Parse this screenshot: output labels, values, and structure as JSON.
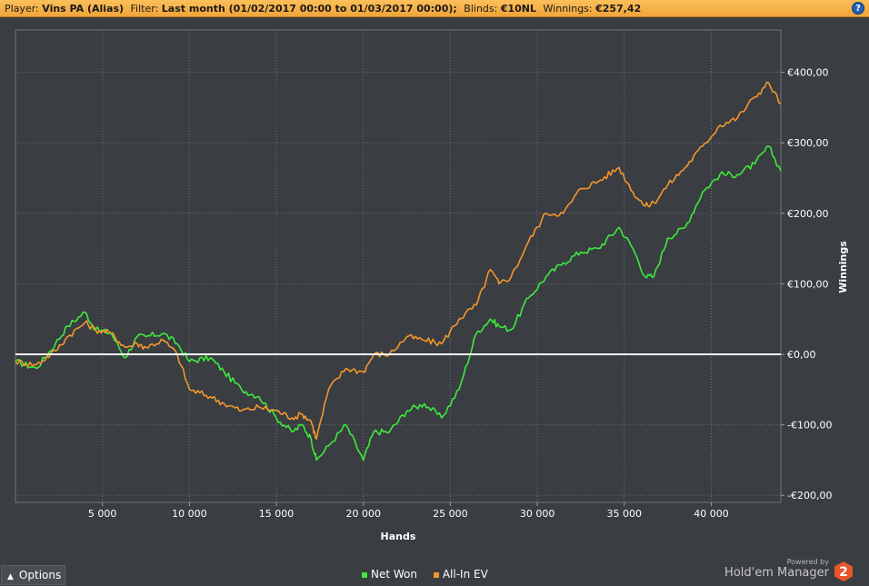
{
  "header": {
    "player_label": "Player:",
    "player_value": "Vins PA (Alias)",
    "filter_label": "Filter:",
    "filter_value": "Last month (01/02/2017 00:00 to 01/03/2017 00:00);",
    "blinds_label": "Blinds:",
    "blinds_value": "€10NL",
    "winnings_label": "Winnings:",
    "winnings_value": "€257,42",
    "help_label": "?"
  },
  "colors": {
    "background": "#3a3d41",
    "header": "#f5ad45",
    "net_won": "#3ee93e",
    "all_in_ev": "#f2962e",
    "zero_line": "#ffffff",
    "grid": "#6b6e73"
  },
  "chart_data": {
    "type": "line",
    "xlabel": "Hands",
    "ylabel": "Winnings",
    "xlim": [
      0,
      44000
    ],
    "ylim": [
      -210,
      460
    ],
    "x_ticks": [
      5000,
      10000,
      15000,
      20000,
      25000,
      30000,
      35000,
      40000
    ],
    "x_tick_labels": [
      "5 000",
      "10 000",
      "15 000",
      "20 000",
      "25 000",
      "30 000",
      "35 000",
      "40 000"
    ],
    "y_ticks": [
      -200,
      -100,
      0,
      100,
      200,
      300,
      400
    ],
    "y_tick_labels": [
      "-€200,00",
      "-€100,00",
      "€0,00",
      "€100,00",
      "€200,00",
      "€300,00",
      "€400,00"
    ],
    "grid": true,
    "legend_position": "bottom-center",
    "series": [
      {
        "name": "Net Won",
        "color": "#3ee93e",
        "x": [
          0,
          1200,
          2300,
          3000,
          4000,
          4600,
          5500,
          6300,
          7000,
          7500,
          8500,
          9300,
          10000,
          11200,
          12000,
          13000,
          14000,
          15000,
          15900,
          16500,
          17000,
          17300,
          18000,
          19000,
          20000,
          20600,
          21500,
          22500,
          23500,
          24500,
          25500,
          26500,
          27300,
          27800,
          28500,
          29500,
          30500,
          31500,
          32500,
          33500,
          34700,
          35500,
          36200,
          36700,
          37500,
          38500,
          39500,
          40500,
          41500,
          42500,
          43300,
          44000
        ],
        "y": [
          -10,
          -20,
          15,
          40,
          60,
          35,
          30,
          -5,
          25,
          25,
          30,
          15,
          -10,
          -5,
          -25,
          -50,
          -60,
          -90,
          -110,
          -100,
          -120,
          -150,
          -130,
          -100,
          -150,
          -110,
          -110,
          -80,
          -70,
          -90,
          -50,
          30,
          50,
          40,
          35,
          80,
          110,
          130,
          145,
          150,
          180,
          150,
          110,
          110,
          165,
          180,
          230,
          255,
          255,
          270,
          295,
          260
        ]
      },
      {
        "name": "All-In EV",
        "color": "#f2962e",
        "x": [
          0,
          1200,
          2300,
          3000,
          4000,
          4600,
          5500,
          6300,
          7000,
          7500,
          8500,
          9300,
          10000,
          11200,
          12000,
          13000,
          14000,
          15000,
          15900,
          16500,
          17000,
          17300,
          18000,
          19000,
          20000,
          20600,
          21500,
          22500,
          23500,
          24500,
          25500,
          26500,
          27300,
          27800,
          28500,
          29500,
          30500,
          31500,
          32500,
          33500,
          34700,
          35500,
          36200,
          36700,
          37500,
          38500,
          39500,
          40500,
          41500,
          42500,
          43300,
          44000
        ],
        "y": [
          -10,
          -15,
          5,
          25,
          45,
          35,
          30,
          10,
          15,
          10,
          20,
          0,
          -50,
          -60,
          -70,
          -80,
          -75,
          -80,
          -90,
          -85,
          -95,
          -120,
          -50,
          -20,
          -25,
          0,
          0,
          25,
          20,
          15,
          50,
          70,
          120,
          100,
          110,
          160,
          200,
          200,
          235,
          245,
          265,
          230,
          210,
          215,
          240,
          265,
          295,
          325,
          335,
          365,
          385,
          355
        ]
      }
    ]
  },
  "footer": {
    "options_label": "Options",
    "powered_by": "Powered by",
    "brand_name": "Hold'em Manager",
    "brand_number": "2"
  }
}
